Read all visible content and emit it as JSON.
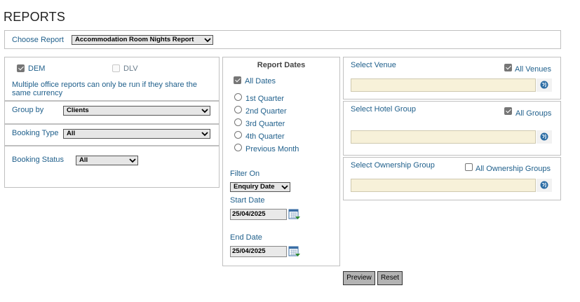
{
  "page": {
    "title": "REPORTS"
  },
  "choose_report": {
    "label": "Choose Report",
    "selected": "Accommodation Room Nights Report"
  },
  "office": {
    "dem": {
      "label": "DEM",
      "checked": true
    },
    "dlv": {
      "label": "DLV",
      "checked": false
    },
    "note": "Multiple office reports can only be run if they share the same currency"
  },
  "group_by": {
    "label": "Group by",
    "selected": "Clients"
  },
  "booking_type": {
    "label": "Booking Type",
    "selected": "All"
  },
  "booking_status": {
    "label": "Booking Status",
    "selected": "All"
  },
  "report_dates": {
    "title": "Report Dates",
    "all_dates": {
      "label": "All Dates",
      "checked": true
    },
    "options": [
      "1st Quarter",
      "2nd Quarter",
      "3rd Quarter",
      "4th Quarter",
      "Previous Month"
    ]
  },
  "filter": {
    "label": "Filter On",
    "selected": "Enquiry Date",
    "start_label": "Start Date",
    "start_value": "25/04/2025",
    "end_label": "End Date",
    "end_value": "25/04/2025"
  },
  "venue": {
    "label": "Select Venue",
    "all_label": "All Venues",
    "all_checked": true,
    "value": ""
  },
  "hotel_group": {
    "label": "Select Hotel Group",
    "all_label": "All Groups",
    "all_checked": true,
    "value": ""
  },
  "ownership_group": {
    "label": "Select Ownership Group",
    "all_label": "All Ownership Groups",
    "all_checked": false,
    "value": ""
  },
  "buttons": {
    "preview": "Preview",
    "reset": "Reset"
  }
}
